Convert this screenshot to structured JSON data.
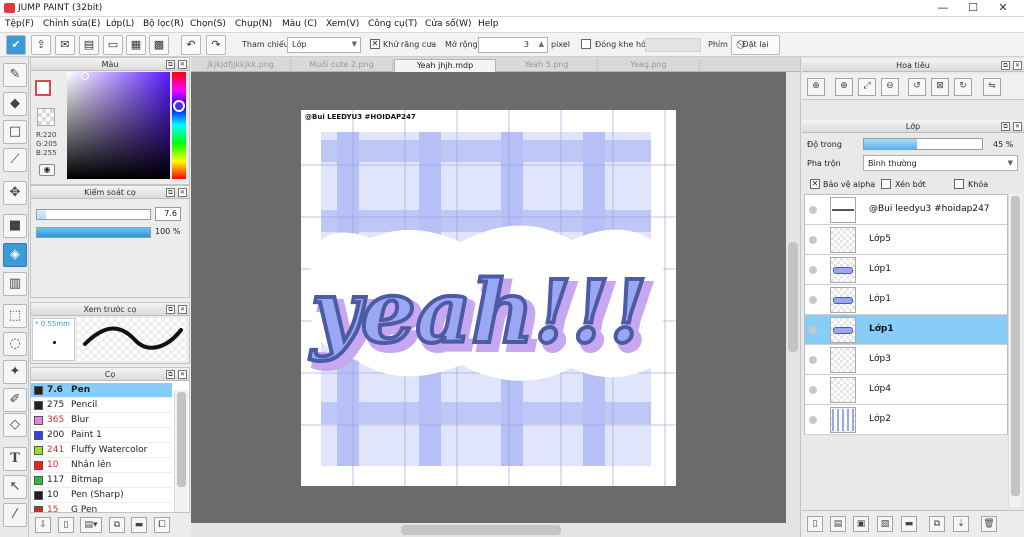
{
  "window": {
    "title": "JUMP PAINT (32bit)",
    "minimize": "—",
    "maximize": "☐",
    "close": "✕"
  },
  "menu": [
    "Tệp(F)",
    "Chỉnh sửa(E)",
    "Lớp(L)",
    "Bộ lọc(R)",
    "Chọn(S)",
    "Chụp(N)",
    "Màu (C)",
    "Xem(V)",
    "Công cụ(T)",
    "Cửa số(W)",
    "Help"
  ],
  "toolbar": {
    "reference_label": "Tham chiếu",
    "reference_value": "Lớp",
    "antialias_label": "Khử răng cưa",
    "expand_label": "Mở rộng",
    "expand_value": "3",
    "unit": "pixel",
    "close_gap_label": "Đóng khe hở",
    "keys_label": "Phím",
    "reset_label": "Đặt lại"
  },
  "color_panel": {
    "title": "Màu",
    "r": "R:220",
    "g": "G:205",
    "b": "B:255",
    "fg": "#d84a55",
    "bg": "#ffffff"
  },
  "brush_control": {
    "title": "Kiểm soát cọ",
    "size": "7.6",
    "opacity": "100 %",
    "size_fraction": 0.08,
    "opacity_fraction": 1.0
  },
  "preview": {
    "title": "Xem trước cọ",
    "size": "* 0.55mm"
  },
  "brushes": {
    "title": "Cọ",
    "items": [
      {
        "size": "7.6",
        "name": "Pen",
        "color": "#222222",
        "selected": true
      },
      {
        "size": "275",
        "name": "Pencil",
        "color": "#222222"
      },
      {
        "size": "365",
        "name": "Blur",
        "color": "#f080e0"
      },
      {
        "size": "200",
        "name": "Paint 1",
        "color": "#3344dd"
      },
      {
        "size": "241",
        "name": "Fluffy Watercolor",
        "color": "#99dd33"
      },
      {
        "size": "10",
        "name": "Nhân lên",
        "color": "#ee2222"
      },
      {
        "size": "117",
        "name": "Bitmap",
        "color": "#33bb33"
      },
      {
        "size": "10",
        "name": "Pen (Sharp)",
        "color": "#222222"
      },
      {
        "size": "15",
        "name": "G Pen",
        "color": "#dd2222"
      }
    ]
  },
  "tabs": [
    "jkjkjdfjjkkjkk.png",
    "Muối cute 2.png",
    "Yeah jhjh.mdp",
    "Yeah 5.png",
    "Yeag.png"
  ],
  "active_tab": 2,
  "canvas": {
    "watermark": "@Bui LEEDYU3 #HOIDAP247",
    "lettering": "yeah!!!"
  },
  "navigator": {
    "title": "Hoa tiêu"
  },
  "layers": {
    "title": "Lớp",
    "opacity_label": "Độ trong",
    "opacity_value": "45 %",
    "opacity_fraction": 0.45,
    "blend_label": "Pha trộn",
    "blend_value": "Bình thường",
    "protect_alpha": "Bảo vệ alpha",
    "clip": "Xén bớt",
    "lock": "Khóa",
    "items": [
      {
        "name": "@Bui leedyu3 #hoidap247",
        "kind": "text"
      },
      {
        "name": "Lớp5",
        "kind": "empty"
      },
      {
        "name": "Lớp1",
        "kind": "sketch"
      },
      {
        "name": "Lớp1",
        "kind": "sketch"
      },
      {
        "name": "Lớp1",
        "kind": "sketch",
        "selected": true
      },
      {
        "name": "Lớp3",
        "kind": "empty"
      },
      {
        "name": "Lớp4",
        "kind": "empty"
      },
      {
        "name": "Lớp2",
        "kind": "grid"
      }
    ]
  },
  "colors": {
    "accent": "#3c9ad7",
    "selection": "#87cdf7",
    "canvas_bg": "#6b6b6b",
    "plaid": "#4b5ee8",
    "lettering": "#9aa7f2",
    "outline": "#4d5aa6"
  }
}
